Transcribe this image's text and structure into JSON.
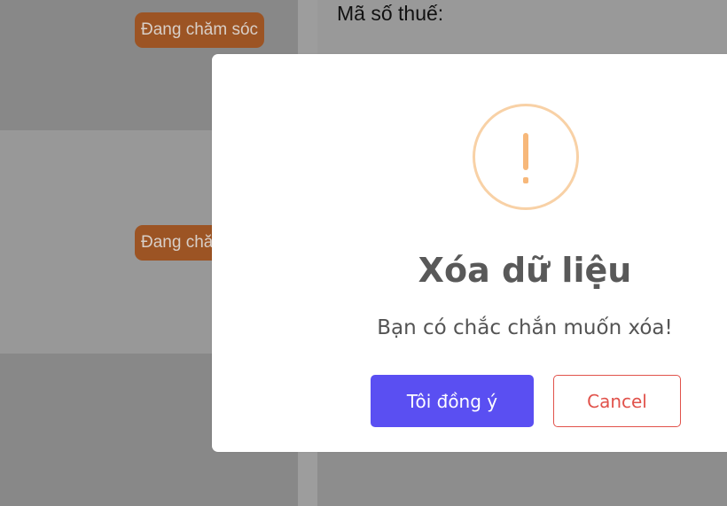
{
  "background": {
    "rows": [
      {
        "status": "Đang chăm sóc"
      },
      {
        "status": "Đang chăm sóc"
      }
    ],
    "tax_label": "Mã số thuế:"
  },
  "modal": {
    "icon": "exclamation-icon",
    "icon_color": "#f7b87a",
    "title": "Xóa dữ liệu",
    "message": "Bạn có chắc chắn muốn xóa!",
    "confirm_label": "Tôi đồng ý",
    "cancel_label": "Cancel",
    "confirm_color": "#5a4ff2",
    "cancel_color": "#e1524b"
  }
}
